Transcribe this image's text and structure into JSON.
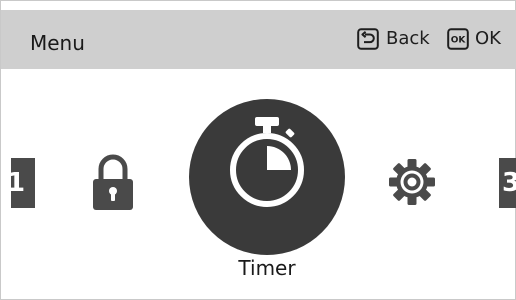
{
  "header": {
    "title": "Menu",
    "back": {
      "icon": "back-arrow-icon",
      "label": "Back"
    },
    "ok": {
      "icon": "ok-key-icon",
      "key_text": "OK",
      "label": "OK"
    }
  },
  "carousel": {
    "prev_page_number": "1",
    "next_page_number": "3",
    "items": [
      {
        "icon": "lock-icon"
      },
      {
        "icon": "timer-icon",
        "label": "Timer",
        "selected": true
      },
      {
        "icon": "gear-icon"
      }
    ]
  },
  "colors": {
    "header_bg": "#cfcfcf",
    "icon": "#4a4a4a",
    "selected_circle": "#3a3a3a"
  }
}
